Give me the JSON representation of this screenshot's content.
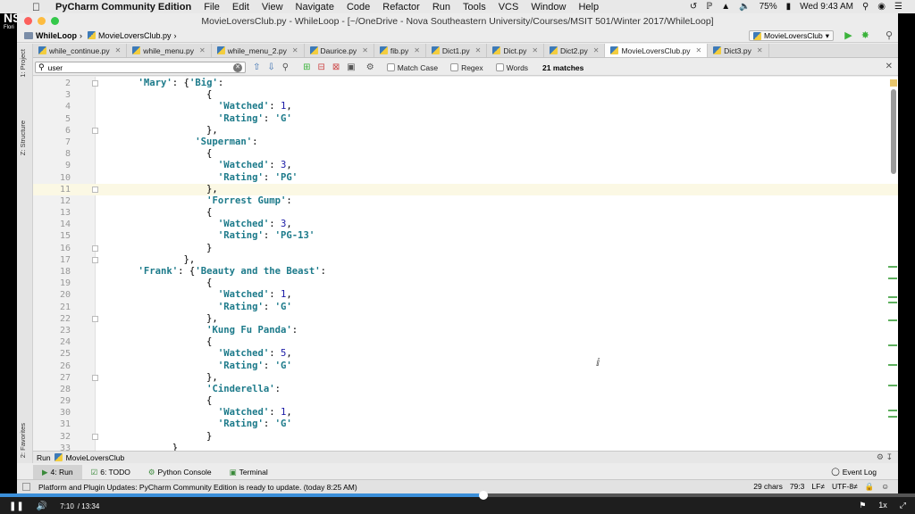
{
  "mac_menubar": {
    "app_name": "PyCharm Community Edition",
    "menus": [
      "File",
      "Edit",
      "View",
      "Navigate",
      "Code",
      "Refactor",
      "Run",
      "Tools",
      "VCS",
      "Window",
      "Help"
    ],
    "battery": "75%",
    "clock": "Wed 9:43 AM"
  },
  "logo": {
    "main": "NSU",
    "sub": "Flori"
  },
  "window": {
    "title": "MovieLoversClub.py - WhileLoop - [~/OneDrive - Nova Southeastern University/Courses/MSIT 501/Winter 2017/WhileLoop]"
  },
  "navbar": {
    "crumb_project": "WhileLoop",
    "crumb_file": "MovieLoversClub.py",
    "run_config": "MovieLoversClub"
  },
  "tabs": [
    {
      "label": "while_continue.py",
      "active": false
    },
    {
      "label": "while_menu.py",
      "active": false
    },
    {
      "label": "while_menu_2.py",
      "active": false
    },
    {
      "label": "Daurice.py",
      "active": false
    },
    {
      "label": "fib.py",
      "active": false
    },
    {
      "label": "Dict1.py",
      "active": false
    },
    {
      "label": "Dict.py",
      "active": false
    },
    {
      "label": "Dict2.py",
      "active": false
    },
    {
      "label": "MovieLoversClub.py",
      "active": true
    },
    {
      "label": "Dict3.py",
      "active": false
    }
  ],
  "search": {
    "value": "user",
    "match_case": "Match Case",
    "regex": "Regex",
    "words": "Words",
    "matches": "21 matches"
  },
  "side_tools": {
    "project": "1: Project",
    "structure": "Z: Structure",
    "favorites": "2: Favorites"
  },
  "code_lines": [
    {
      "n": "2",
      "code": "    <s>'Mary'</s>: {<s>'Big'</s>:"
    },
    {
      "n": "3",
      "code": "                {"
    },
    {
      "n": "4",
      "code": "                  <s>'Watched'</s>: <i>1</i>,"
    },
    {
      "n": "5",
      "code": "                  <s>'Rating'</s>: <s>'G'</s>"
    },
    {
      "n": "6",
      "code": "                },"
    },
    {
      "n": "7",
      "code": "              <s>'Superman'</s>:"
    },
    {
      "n": "8",
      "code": "                {"
    },
    {
      "n": "9",
      "code": "                  <s>'Watched'</s>: <i>3</i>,"
    },
    {
      "n": "10",
      "code": "                  <s>'Rating'</s>: <s>'PG'</s>"
    },
    {
      "n": "11",
      "code": "                },",
      "cur": true
    },
    {
      "n": "12",
      "code": "                <s>'Forrest Gump'</s>:"
    },
    {
      "n": "13",
      "code": "                {"
    },
    {
      "n": "14",
      "code": "                  <s>'Watched'</s>: <i>3</i>,"
    },
    {
      "n": "15",
      "code": "                  <s>'Rating'</s>: <s>'PG-13'</s>"
    },
    {
      "n": "16",
      "code": "                }"
    },
    {
      "n": "17",
      "code": "            },"
    },
    {
      "n": "18",
      "code": "    <s>'Frank'</s>: {<s>'Beauty and the Beast'</s>:"
    },
    {
      "n": "19",
      "code": "                {"
    },
    {
      "n": "20",
      "code": "                  <s>'Watched'</s>: <i>1</i>,"
    },
    {
      "n": "21",
      "code": "                  <s>'Rating'</s>: <s>'G'</s>"
    },
    {
      "n": "22",
      "code": "                },"
    },
    {
      "n": "23",
      "code": "                <s>'Kung Fu Panda'</s>:"
    },
    {
      "n": "24",
      "code": "                {"
    },
    {
      "n": "25",
      "code": "                  <s>'Watched'</s>: <i>5</i>,"
    },
    {
      "n": "26",
      "code": "                  <s>'Rating'</s>: <s>'G'</s>"
    },
    {
      "n": "27",
      "code": "                },"
    },
    {
      "n": "28",
      "code": "                <s>'Cinderella'</s>:"
    },
    {
      "n": "29",
      "code": "                {"
    },
    {
      "n": "30",
      "code": "                  <s>'Watched'</s>: <i>1</i>,"
    },
    {
      "n": "31",
      "code": "                  <s>'Rating'</s>: <s>'G'</s>"
    },
    {
      "n": "32",
      "code": "                }"
    },
    {
      "n": "33",
      "code": "          }"
    }
  ],
  "run_panel": {
    "label": "Run",
    "config": "MovieLoversClub"
  },
  "bottom_tabs": [
    {
      "label": "4: Run",
      "active": true
    },
    {
      "label": "6: TODO",
      "active": false
    },
    {
      "label": "Python Console",
      "active": false
    },
    {
      "label": "Terminal",
      "active": false
    }
  ],
  "event_log": "Event Log",
  "status": {
    "message": "Platform and Plugin Updates: PyCharm Community Edition is ready to update. (today 8:25 AM)",
    "chars": "29 chars",
    "position": "79:3",
    "line_sep": "LF≠",
    "encoding": "UTF-8≠"
  },
  "video": {
    "current": "7:10",
    "duration": "/ 13:34",
    "speed": "1x",
    "progress_fraction": 0.528
  }
}
